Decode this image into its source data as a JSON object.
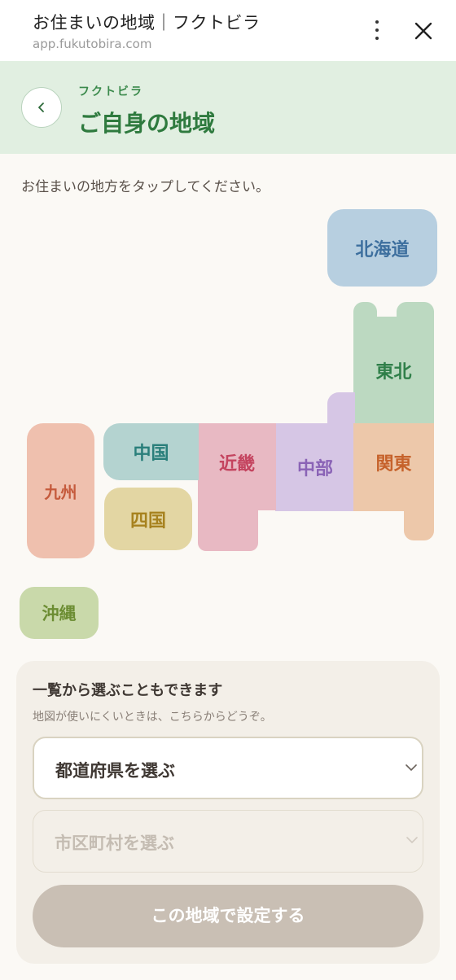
{
  "browser": {
    "title": "お住まいの地域｜フクトビラ",
    "url": "app.fukutobira.com"
  },
  "header": {
    "subtitle": "フクトビラ",
    "title": "ご自身の地域",
    "back_icon": "chevron-left-icon"
  },
  "instruction": "お住まいの地方をタップしてください。",
  "regions": {
    "hokkaido": {
      "label": "北海道",
      "color": "#3d6f9e",
      "bg": "#b7cfe0"
    },
    "tohoku": {
      "label": "東北",
      "color": "#2f7f49",
      "bg": "#bcd9c1"
    },
    "kanto": {
      "label": "関東",
      "color": "#c6622b",
      "bg": "#edc8aa"
    },
    "chubu": {
      "label": "中部",
      "color": "#8a63b6",
      "bg": "#d6c6e5"
    },
    "kinki": {
      "label": "近畿",
      "color": "#c4445f",
      "bg": "#e8b9c3"
    },
    "chugoku": {
      "label": "中国",
      "color": "#2a7f7b",
      "bg": "#b4d3d0"
    },
    "shikoku": {
      "label": "四国",
      "color": "#a7821f",
      "bg": "#e3d6a3"
    },
    "kyushu": {
      "label": "九州",
      "color": "#c55a3c",
      "bg": "#efc0ae"
    },
    "okinawa": {
      "label": "沖縄",
      "color": "#6c8d33",
      "bg": "#c9d9aa"
    }
  },
  "panel": {
    "title": "一覧から選ぶこともできます",
    "subtitle": "地図が使いにくいときは、こちらからどうぞ。",
    "prefecture_select": "都道府県を選ぶ",
    "city_select": "市区町村を選ぶ",
    "submit_label": "この地域で設定する"
  }
}
